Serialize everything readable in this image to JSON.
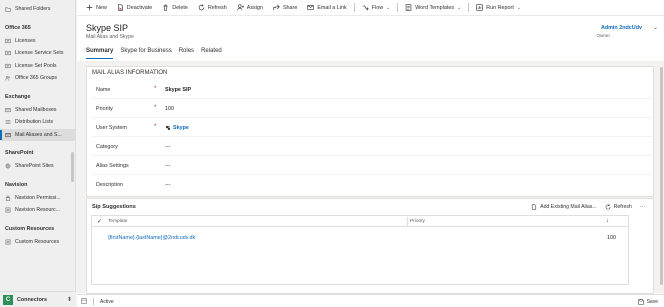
{
  "sidebar": {
    "items": [
      {
        "type": "item",
        "label": "Shared Folders",
        "icon": "folder-icon"
      },
      {
        "type": "group",
        "label": "Office 365"
      },
      {
        "type": "item",
        "label": "Licenses",
        "icon": "license-icon"
      },
      {
        "type": "item",
        "label": "License Service Sets",
        "icon": "license-icon"
      },
      {
        "type": "item",
        "label": "License Set Pools",
        "icon": "license-icon"
      },
      {
        "type": "item",
        "label": "Office 365 Groups",
        "icon": "group-icon"
      },
      {
        "type": "group",
        "label": "Exchange"
      },
      {
        "type": "item",
        "label": "Shared Mailboxes",
        "icon": "mailbox-icon"
      },
      {
        "type": "item",
        "label": "Distribution Lists",
        "icon": "list-icon"
      },
      {
        "type": "item",
        "label": "Mail Aliases and S...",
        "icon": "mail-icon",
        "active": true
      },
      {
        "type": "group",
        "label": "SharePoint"
      },
      {
        "type": "item",
        "label": "SharePoint Sites",
        "icon": "site-icon"
      },
      {
        "type": "group",
        "label": "Navision"
      },
      {
        "type": "item",
        "label": "Navision Permissi...",
        "icon": "permission-icon"
      },
      {
        "type": "item",
        "label": "Navision Resourc...",
        "icon": "resource-icon"
      },
      {
        "type": "group",
        "label": "Custom Resources"
      },
      {
        "type": "item",
        "label": "Custom Resources",
        "icon": "resource-icon"
      }
    ],
    "area": {
      "badge": "C",
      "label": "Connectors"
    }
  },
  "commands": [
    {
      "label": "New",
      "icon": "plus-icon"
    },
    {
      "label": "Deactivate",
      "icon": "deactivate-icon"
    },
    {
      "label": "Delete",
      "icon": "trash-icon"
    },
    {
      "label": "Refresh",
      "icon": "refresh-icon"
    },
    {
      "label": "Assign",
      "icon": "assign-icon"
    },
    {
      "label": "Share",
      "icon": "share-icon"
    },
    {
      "label": "Email a Link",
      "icon": "email-icon"
    },
    {
      "label": "Flow",
      "icon": "flow-icon",
      "dropdown": true
    },
    {
      "label": "Word Templates",
      "icon": "word-icon",
      "dropdown": true
    },
    {
      "label": "Run Report",
      "icon": "report-icon",
      "dropdown": true
    }
  ],
  "record": {
    "title": "Skype SIP",
    "subtitle": "Mail Alias and Skype",
    "owner_name": "Admin 2ndcUdv",
    "owner_label": "Owner"
  },
  "tabs": [
    {
      "label": "Summary",
      "active": true
    },
    {
      "label": "Skype for Business"
    },
    {
      "label": "Roles"
    },
    {
      "label": "Related"
    }
  ],
  "section": {
    "title": "MAIL ALIAS INFORMATION",
    "fields": [
      {
        "label": "Name",
        "value": "Skype SIP",
        "required": true
      },
      {
        "label": "Priority",
        "value": "100",
        "required": true
      },
      {
        "label": "User System",
        "value": "Skype",
        "required": true,
        "link": true
      },
      {
        "label": "Category",
        "value": "---"
      },
      {
        "label": "Alias Settings",
        "value": "---"
      },
      {
        "label": "Description",
        "value": "---"
      }
    ]
  },
  "subgrid": {
    "title": "Sip Suggestions",
    "add_label": "Add Existing Mail Alias...",
    "refresh_label": "Refresh",
    "more_label": "···",
    "col_template": "Template",
    "col_priority": "Priority",
    "rows": [
      {
        "template": "{firstName}.{lastName}@2ndcudv.dk",
        "priority": "100"
      }
    ]
  },
  "footer": {
    "status": "Active",
    "save_label": "Save"
  },
  "colors": {
    "accent": "#0f6cbd",
    "required": "#a4262c",
    "area_badge": "#2f8f5b"
  }
}
